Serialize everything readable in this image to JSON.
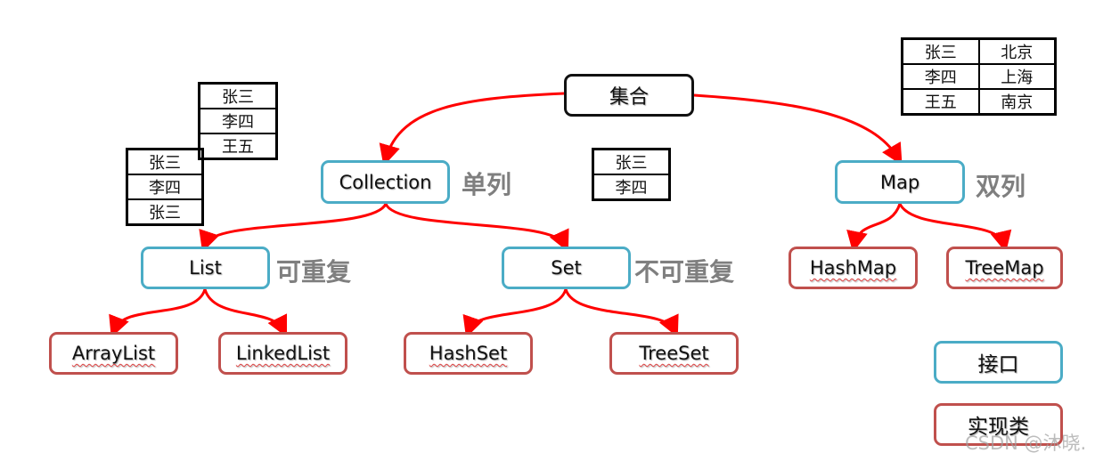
{
  "root": "集合",
  "interfaces": {
    "collection": "Collection",
    "map": "Map",
    "list": "List",
    "set": "Set"
  },
  "notes": {
    "collection": "单列",
    "map": "双列",
    "list": "可重复",
    "set": "不可重复"
  },
  "impls": {
    "arraylist": "ArrayList",
    "linkedlist": "LinkedList",
    "hashset": "HashSet",
    "treeset": "TreeSet",
    "hashmap": "HashMap",
    "treemap": "TreeMap"
  },
  "legend": {
    "interface": "接口",
    "impl": "实现类"
  },
  "tables": {
    "list_back": [
      "张三",
      "李四",
      "王五"
    ],
    "list_front": [
      "张三",
      "李四",
      "张三"
    ],
    "set": [
      "张三",
      "李四"
    ],
    "map": [
      [
        "张三",
        "北京"
      ],
      [
        "李四",
        "上海"
      ],
      [
        "王五",
        "南京"
      ]
    ]
  },
  "colors": {
    "interface": "#4bacc6",
    "impl": "#c0504d",
    "arrow": "#ff0000",
    "note": "#7f7f7f"
  },
  "watermark": "CSDN @沐晓."
}
